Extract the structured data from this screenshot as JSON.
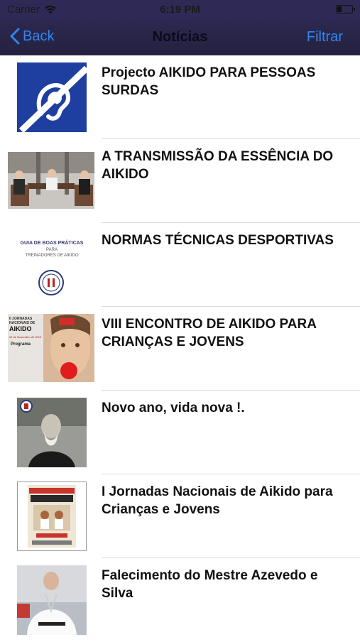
{
  "status_bar": {
    "carrier": "Carrier",
    "time": "6:19 PM",
    "battery_level": 0.3
  },
  "nav": {
    "back_label": "Back",
    "title": "Notícias",
    "filter_label": "Filtrar"
  },
  "news": [
    {
      "title": "Projecto AIKIDO PARA PESSOAS SURDAS"
    },
    {
      "title": "A TRANSMISSÃO DA ESSÊNCIA DO AIKIDO"
    },
    {
      "title": "NORMAS TÉCNICAS DESPORTIVAS",
      "thumb_text": [
        "GUIA DE BOAS PRÁTICAS",
        "PARA",
        "TREINADORES DE AIKIDO"
      ]
    },
    {
      "title": "VIII ENCONTRO DE AIKIDO PARA CRIANÇAS E JOVENS",
      "thumb_text": [
        "II JORNADAS",
        "NACIONAIS DE",
        "AIKIDO",
        "02 de Novembro de 2019",
        "Programa"
      ]
    },
    {
      "title": "Novo ano, vida nova !."
    },
    {
      "title": "I Jornadas Nacionais de Aikido para Crianças e Jovens"
    },
    {
      "title": "Falecimento do Mestre Azevedo e Silva"
    }
  ],
  "colors": {
    "accent": "#2f86f2",
    "navbar": "#2c2850"
  }
}
